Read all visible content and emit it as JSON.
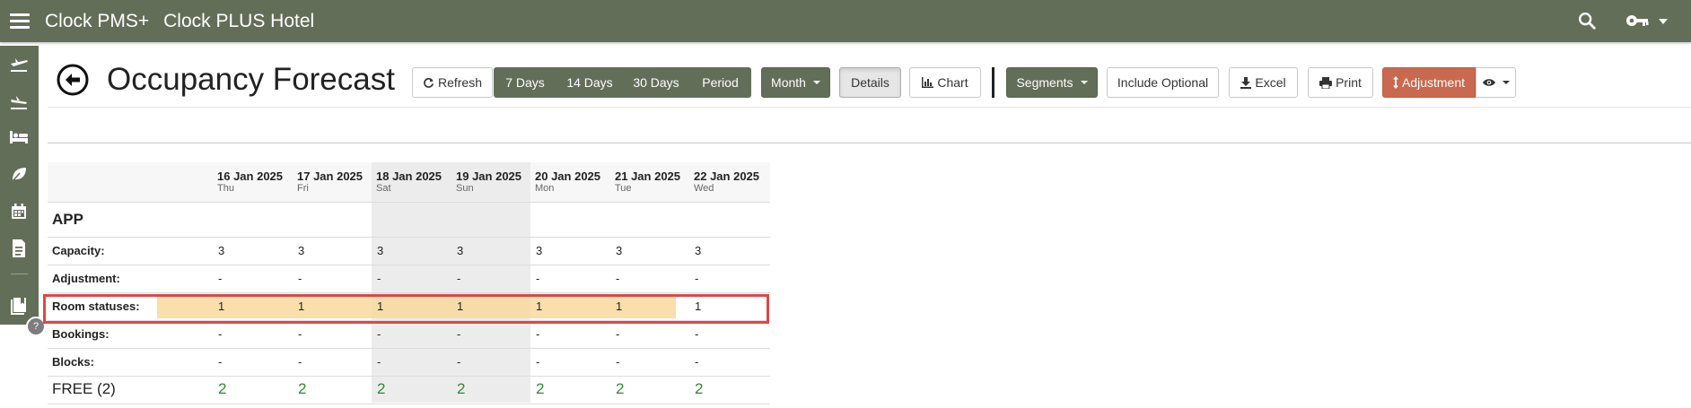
{
  "topbar": {
    "brand": "Clock PMS+",
    "hotel": "Clock PLUS Hotel"
  },
  "page": {
    "title": "Occupancy Forecast"
  },
  "toolbar": {
    "refresh": "Refresh",
    "ranges": [
      "7 Days",
      "14 Days",
      "30 Days",
      "Period"
    ],
    "month": "Month",
    "details": "Details",
    "chart": "Chart",
    "segments": "Segments",
    "include_optional": "Include Optional",
    "excel": "Excel",
    "print": "Print",
    "adjustment": "Adjustment"
  },
  "table": {
    "columns": [
      {
        "date": "16 Jan 2025",
        "weekday": "Thu"
      },
      {
        "date": "17 Jan 2025",
        "weekday": "Fri"
      },
      {
        "date": "18 Jan 2025",
        "weekday": "Sat"
      },
      {
        "date": "19 Jan 2025",
        "weekday": "Sun"
      },
      {
        "date": "20 Jan 2025",
        "weekday": "Mon"
      },
      {
        "date": "21 Jan 2025",
        "weekday": "Tue"
      },
      {
        "date": "22 Jan 2025",
        "weekday": "Wed"
      }
    ],
    "group": "APP",
    "rows": [
      {
        "label": "Capacity:",
        "values": [
          "3",
          "3",
          "3",
          "3",
          "3",
          "3",
          "3"
        ]
      },
      {
        "label": "Adjustment:",
        "values": [
          "-",
          "-",
          "-",
          "-",
          "-",
          "-",
          "-"
        ]
      },
      {
        "label": "Room statuses:",
        "values": [
          "1",
          "1",
          "1",
          "1",
          "1",
          "1",
          "1"
        ]
      },
      {
        "label": "Bookings:",
        "values": [
          "-",
          "-",
          "-",
          "-",
          "-",
          "-",
          "-"
        ]
      },
      {
        "label": "Blocks:",
        "values": [
          "-",
          "-",
          "-",
          "-",
          "-",
          "-",
          "-"
        ]
      }
    ],
    "free": {
      "label": "FREE (2)",
      "values": [
        "2",
        "2",
        "2",
        "2",
        "2",
        "2",
        "2"
      ]
    }
  },
  "help": {
    "label": "?"
  },
  "colors": {
    "brand": "#636e58",
    "adjustment": "#c9694f",
    "free": "#2f8a2f",
    "highlight": "#f7d99c",
    "highlight_border": "#e04646"
  }
}
